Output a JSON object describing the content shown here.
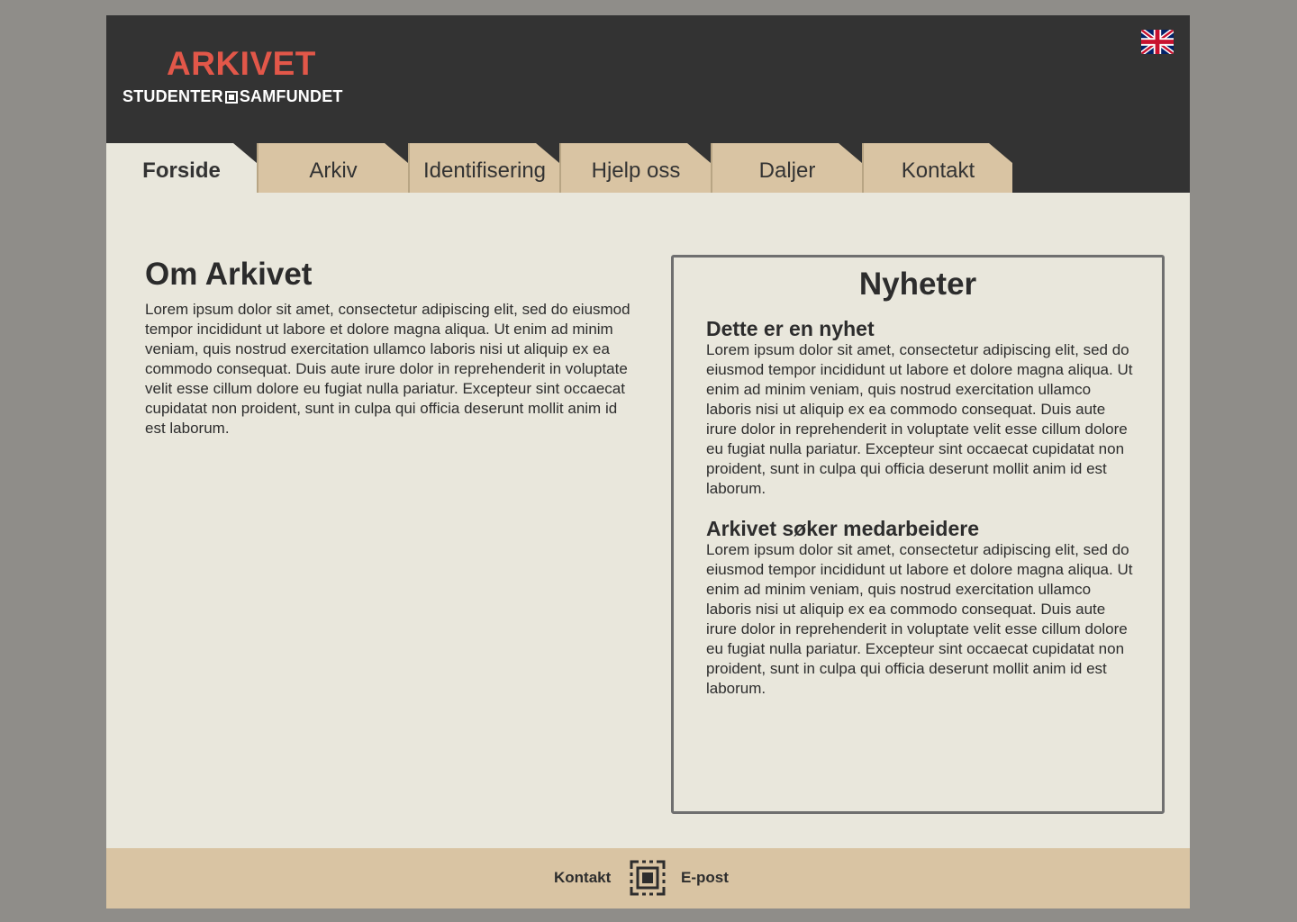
{
  "header": {
    "title": "ARKIVET",
    "subtitle_left": "STUDENTER",
    "subtitle_right": "SAMFUNDET",
    "language_icon": "uk-flag-icon"
  },
  "nav": {
    "tabs": [
      {
        "label": "Forside",
        "active": true
      },
      {
        "label": "Arkiv",
        "active": false
      },
      {
        "label": "Identifisering",
        "active": false
      },
      {
        "label": "Hjelp oss",
        "active": false
      },
      {
        "label": "Daljer",
        "active": false
      },
      {
        "label": "Kontakt",
        "active": false
      }
    ]
  },
  "about": {
    "heading": "Om Arkivet",
    "body": "Lorem ipsum dolor sit amet, consectetur adipiscing elit, sed do eiusmod tempor incididunt ut labore et dolore magna aliqua. Ut enim ad minim veniam, quis nostrud exercitation ullamco laboris nisi ut aliquip ex ea commodo consequat. Duis aute irure dolor in reprehenderit in voluptate velit esse cillum dolore eu fugiat nulla pariatur. Excepteur sint occaecat cupidatat non proident, sunt in culpa qui officia deserunt mollit anim id est laborum."
  },
  "news": {
    "heading": "Nyheter",
    "items": [
      {
        "title": "Dette er en nyhet",
        "body": "Lorem ipsum dolor sit amet, consectetur adipiscing elit, sed do eiusmod tempor incididunt ut labore et dolore magna aliqua. Ut enim ad minim veniam, quis nostrud exercitation ullamco laboris nisi ut aliquip ex ea commodo consequat. Duis aute irure dolor in reprehenderit in voluptate velit esse cillum dolore eu fugiat nulla pariatur. Excepteur sint occaecat cupidatat non proident, sunt in culpa qui officia deserunt mollit anim id est laborum."
      },
      {
        "title": "Arkivet søker medarbeidere",
        "body": "Lorem ipsum dolor sit amet, consectetur adipiscing elit, sed do eiusmod tempor incididunt ut labore et dolore magna aliqua. Ut enim ad minim veniam, quis nostrud exercitation ullamco laboris nisi ut aliquip ex ea commodo consequat. Duis aute irure dolor in reprehenderit in voluptate velit esse cillum dolore eu fugiat nulla pariatur. Excepteur sint occaecat cupidatat non proident, sunt in culpa qui officia deserunt mollit anim id est laborum."
      }
    ]
  },
  "footer": {
    "contact_label": "Kontakt",
    "email_label": "E-post",
    "icon": "samfundet-logo-icon"
  },
  "colors": {
    "header_bg": "#333333",
    "accent_red": "#e25749",
    "tab_bg": "#d9c4a3",
    "page_bg": "#e9e7dc"
  }
}
